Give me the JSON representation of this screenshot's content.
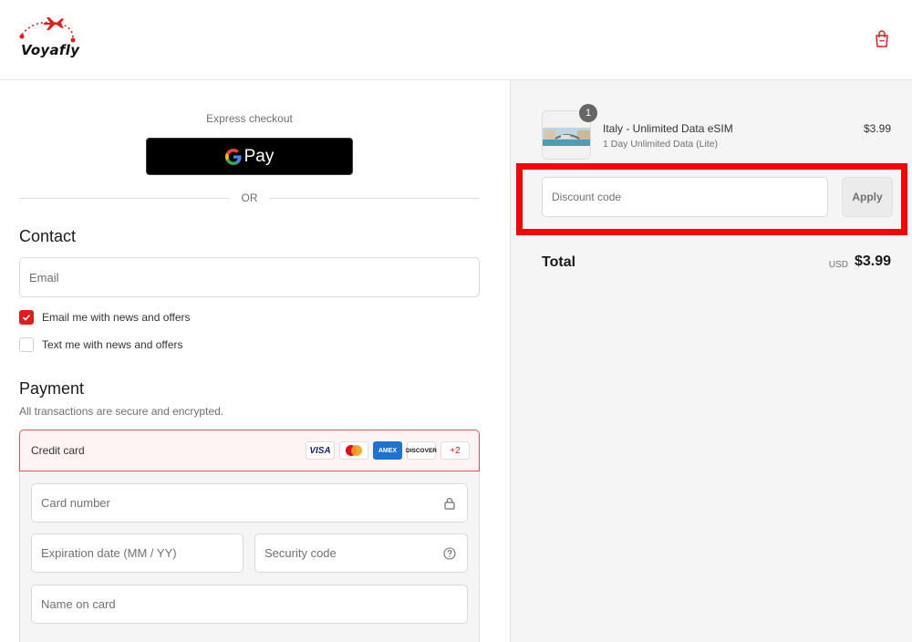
{
  "header": {
    "logo_text": "Voyafly",
    "cart_icon": "shopping-bag-icon",
    "accent_color": "#e01c1c"
  },
  "checkout": {
    "express_label": "Express checkout",
    "gpay_label": "Pay",
    "or_label": "OR"
  },
  "contact": {
    "title": "Contact",
    "email_placeholder": "Email",
    "email_news_label": "Email me with news and offers",
    "email_news_checked": true,
    "text_news_label": "Text me with news and offers",
    "text_news_checked": false
  },
  "payment": {
    "title": "Payment",
    "subtitle": "All transactions are secure and encrypted.",
    "method_label": "Credit card",
    "cards": [
      "VISA",
      "Mastercard",
      "AMEX",
      "DISCOVER",
      "+2"
    ],
    "card_number_placeholder": "Card number",
    "expiration_placeholder": "Expiration date (MM / YY)",
    "security_placeholder": "Security code",
    "name_placeholder": "Name on card"
  },
  "summary": {
    "product_name": "Italy - Unlimited Data eSIM",
    "product_variant": "1 Day Unlimited Data (Lite)",
    "product_price": "$3.99",
    "quantity": "1",
    "discount_placeholder": "Discount code",
    "apply_label": "Apply",
    "total_label": "Total",
    "currency": "USD",
    "total_amount": "$3.99"
  }
}
